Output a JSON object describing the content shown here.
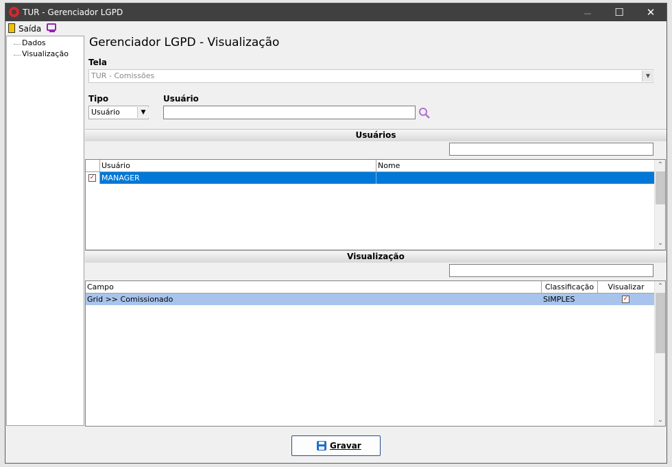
{
  "window": {
    "title": "TUR - Gerenciador LGPD",
    "minimize_glyph": "—",
    "maximize_glyph": "☐",
    "close_glyph": "✕"
  },
  "menu": {
    "exit_label": "Saída"
  },
  "tree": {
    "items": [
      "Dados",
      "Visualização"
    ]
  },
  "page": {
    "title": "Gerenciador LGPD - Visualização"
  },
  "tela": {
    "label": "Tela",
    "value": "TUR - Comissões"
  },
  "tipo": {
    "label": "Tipo",
    "value": "Usuário"
  },
  "usuario": {
    "label": "Usuário",
    "value": ""
  },
  "usuarios_section": {
    "header": "Usuários",
    "search_value": "",
    "columns": [
      "Usuário",
      "Nome"
    ],
    "rows": [
      {
        "checked": true,
        "usuario": "MANAGER",
        "nome": ""
      }
    ]
  },
  "visualizacao_section": {
    "header": "Visualização",
    "search_value": "",
    "columns": [
      "Campo",
      "Classificação",
      "Visualizar"
    ],
    "rows": [
      {
        "campo": "Grid >> Comissionado",
        "classificacao": "SIMPLES",
        "visualizar": true
      }
    ]
  },
  "footer": {
    "save_label": "Gravar"
  },
  "colors": {
    "titlebar": "#404040",
    "selected_row": "#0078d7",
    "highlight_row": "#a8c4ec",
    "accent_purple": "#9b1fb3",
    "check_red": "#d00000"
  },
  "icons": [
    "app-logo-icon",
    "exit-door-icon",
    "monitor-icon",
    "search-icon",
    "dropdown-arrow-icon",
    "scroll-up-icon",
    "scroll-down-icon",
    "save-icon"
  ]
}
